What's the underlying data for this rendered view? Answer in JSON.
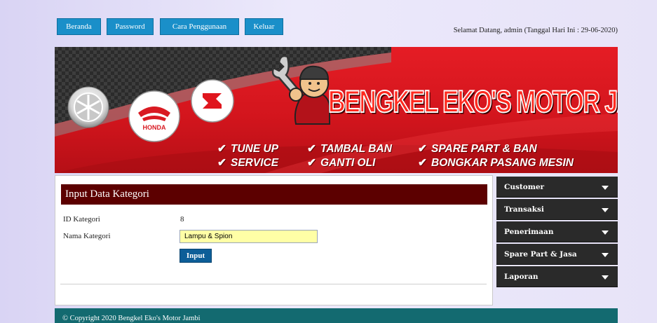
{
  "nav": {
    "items": [
      {
        "label": "Beranda"
      },
      {
        "label": "Password"
      },
      {
        "label": "Cara Penggunaan"
      },
      {
        "label": "Keluar"
      }
    ],
    "welcome": "Selamat Datang, admin (Tanggal Hari Ini : 29-06-2020)"
  },
  "banner": {
    "title": "BENGKEL EKO'S MOTOR JAMBI",
    "brand_honda": "HONDA",
    "services": [
      "TUNE UP",
      "TAMBAL BAN",
      "SPARE PART & BAN",
      "SERVICE",
      "GANTI OLI",
      "BONGKAR PASANG MESIN"
    ],
    "check_glyph": "✔"
  },
  "form": {
    "heading": "Input Data Kategori",
    "id_label": "ID Kategori",
    "id_value": "8",
    "name_label": "Nama Kategori",
    "name_value": "Lampu & Spion",
    "submit_label": "Input"
  },
  "sidebar": {
    "items": [
      {
        "label": "Customer"
      },
      {
        "label": "Transaksi"
      },
      {
        "label": "Penerimaan"
      },
      {
        "label": "Spare Part & Jasa"
      },
      {
        "label": "Laporan"
      }
    ]
  },
  "footer": {
    "text": "© Copyright 2020 Bengkel Eko's Motor Jambi"
  },
  "colors": {
    "nav_button": "#1a8fc9",
    "banner_red": "#d3151d",
    "form_header": "#5c0000",
    "sidebar": "#2a2a2a",
    "footer": "#136a70",
    "input_bg": "#ffffa6",
    "submit_button": "#0d5e98"
  }
}
